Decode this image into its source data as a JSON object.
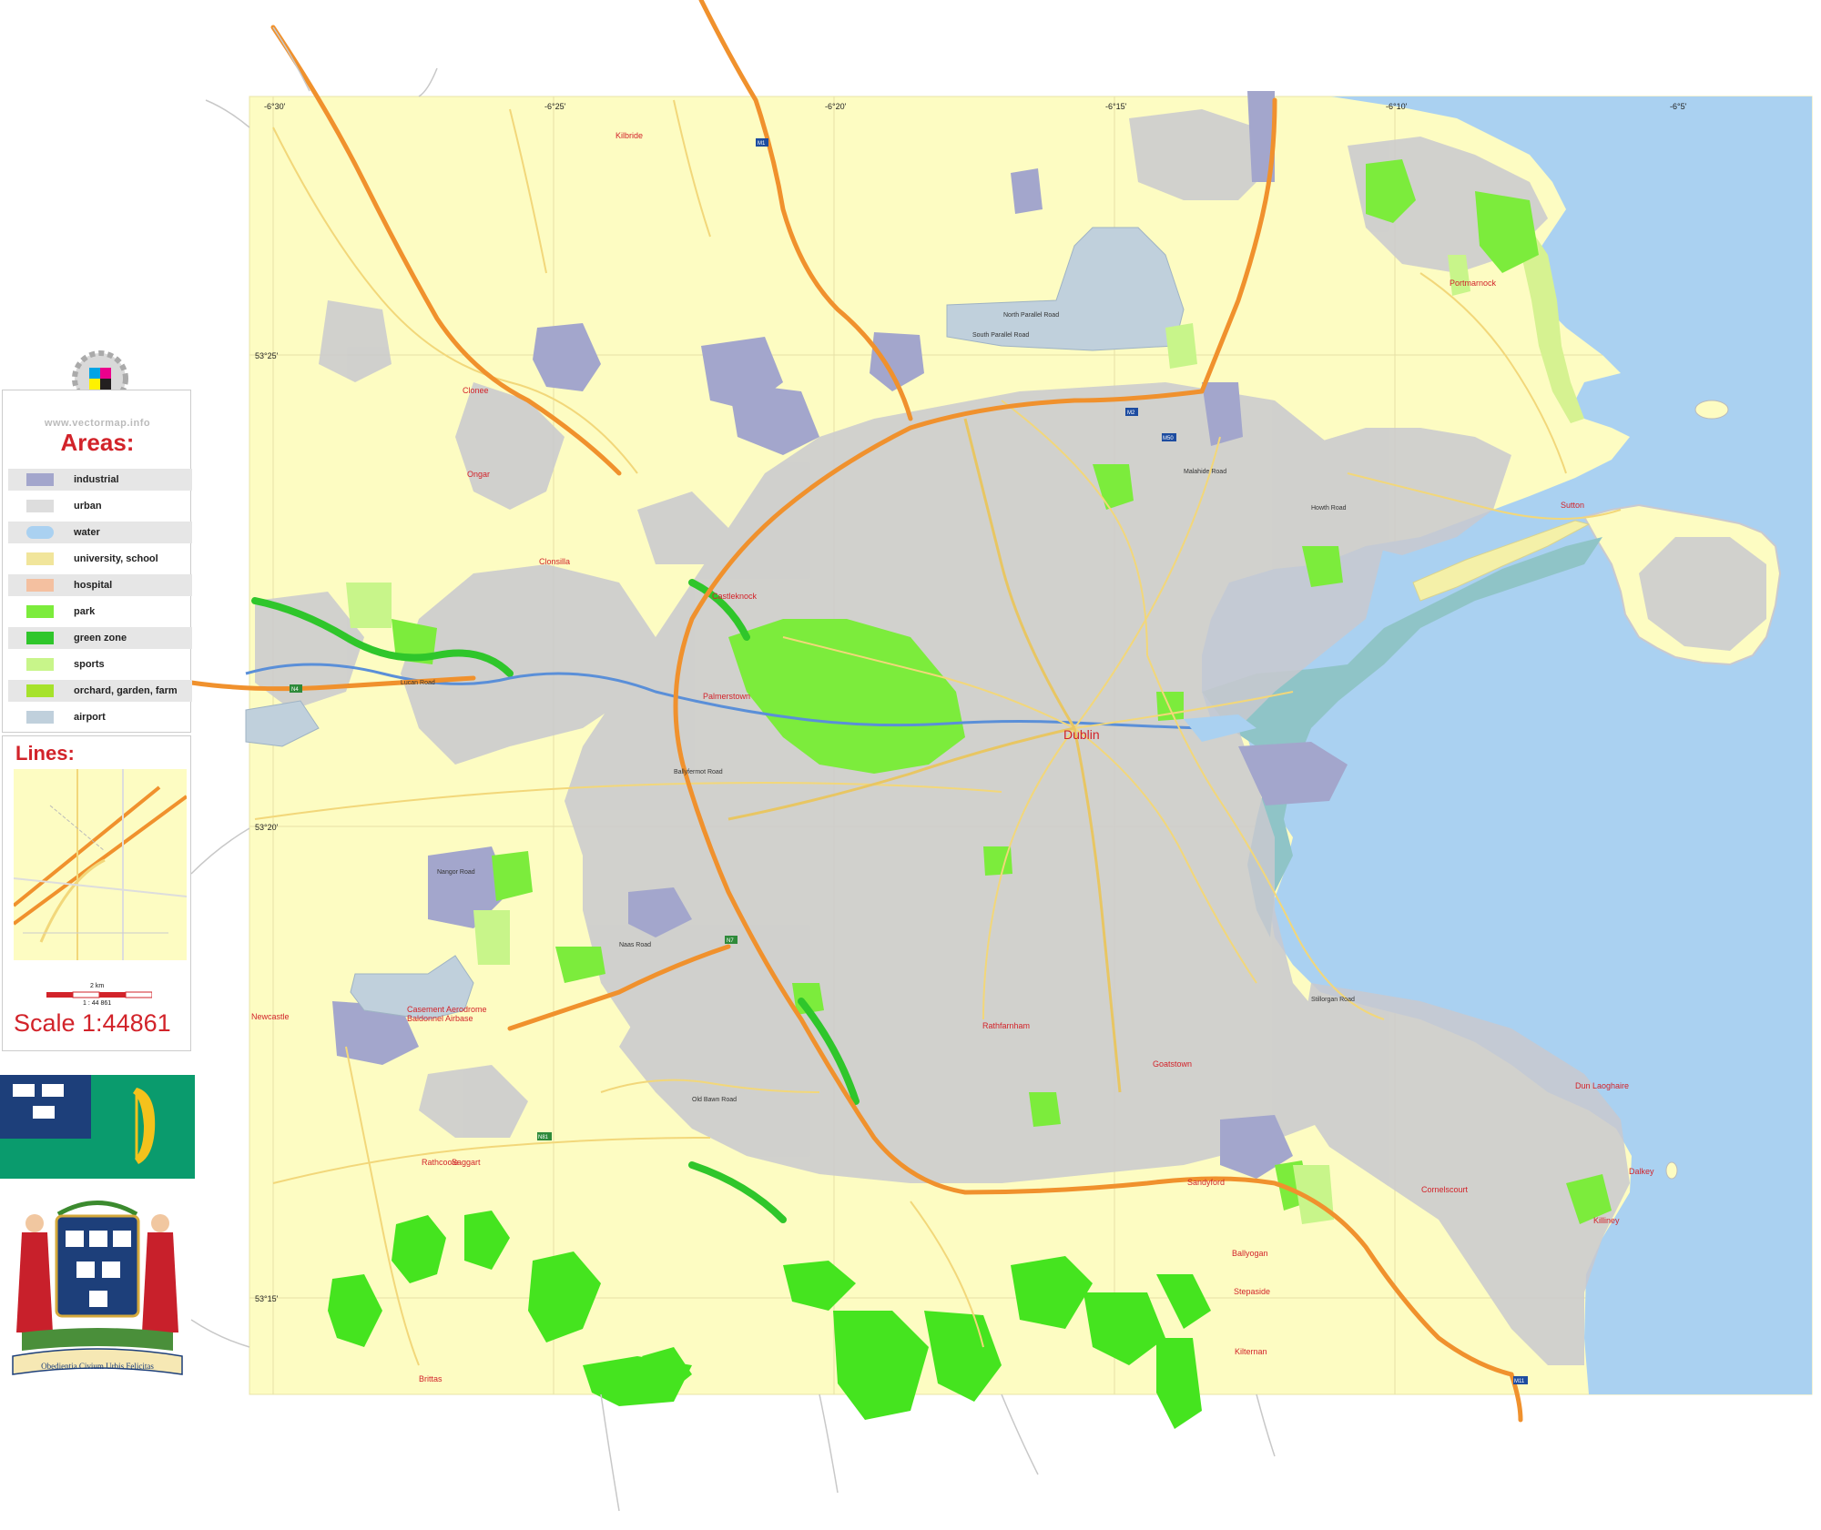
{
  "map": {
    "city_label": "Dublin",
    "longitude_ticks": [
      "-6°30'",
      "-6°25'",
      "-6°20'",
      "-6°15'",
      "-6°10'",
      "-6°5'"
    ],
    "latitude_ticks": [
      "53°25'",
      "53°20'",
      "53°15'"
    ],
    "motorway_shields": [
      "M1",
      "M50",
      "N7",
      "N4",
      "M11",
      "N81",
      "M2"
    ],
    "place_labels": [
      "Kilbride",
      "Clonee",
      "Ongar",
      "Clonsilla",
      "Castleknock",
      "Palmerstown",
      "Newcastle",
      "Rathcoole",
      "Saggart",
      "Rathfarnham",
      "Goatstown",
      "Sandyford",
      "Stepaside",
      "Ballyogan",
      "Kilternan",
      "Cornelscourt",
      "Dun Laoghaire",
      "Dalkey",
      "Killiney",
      "Portmarnock",
      "Sutton",
      "Baldonnel Airbase",
      "Casement Aerodrome",
      "Brittas"
    ],
    "road_labels": [
      "Lucan Road",
      "North Parallel Road",
      "South Parallel Road",
      "Naas Road",
      "Nangor Road",
      "Ballyfermot Road",
      "Howth Road",
      "Malahide Road",
      "Stillorgan Road",
      "Old Bawn Road"
    ],
    "colors": {
      "background": "#fdfcc2",
      "urban": "#c9c9cf",
      "industrial": "#a3a6cc",
      "park": "#7cec3c",
      "green_zone": "#2fc62b",
      "forest": "#45e41f",
      "water": "#aad1f1",
      "mudflat": "#8fc4c7",
      "motorway": "#f0912d",
      "road": "#f2d77a",
      "river": "#5a8fd8",
      "airport": "#c0d0dc"
    }
  },
  "legend": {
    "site": "www.vectormap.info",
    "areas_title": "Areas:",
    "items": [
      {
        "label": "industrial",
        "color": "#a3a6cc"
      },
      {
        "label": "urban",
        "color": "#dddddd"
      },
      {
        "label": "water",
        "color": "#aad1f1"
      },
      {
        "label": "university, school",
        "color": "#f1e59b"
      },
      {
        "label": "hospital",
        "color": "#f4c0a0"
      },
      {
        "label": "park",
        "color": "#7cec3c"
      },
      {
        "label": "green zone",
        "color": "#2fc62b"
      },
      {
        "label": "sports",
        "color": "#c8f58a"
      },
      {
        "label": "orchard, garden, farm",
        "color": "#a6e22b"
      },
      {
        "label": "airport",
        "color": "#c0d0dc"
      }
    ],
    "lines_title": "Lines:",
    "scale_km": "2 km",
    "scale_ratio_small": "1 : 44 861",
    "scale_text": "Scale  1:44861"
  },
  "crest": {
    "motto": "Obedientia Civium Urbis Felicitas"
  }
}
